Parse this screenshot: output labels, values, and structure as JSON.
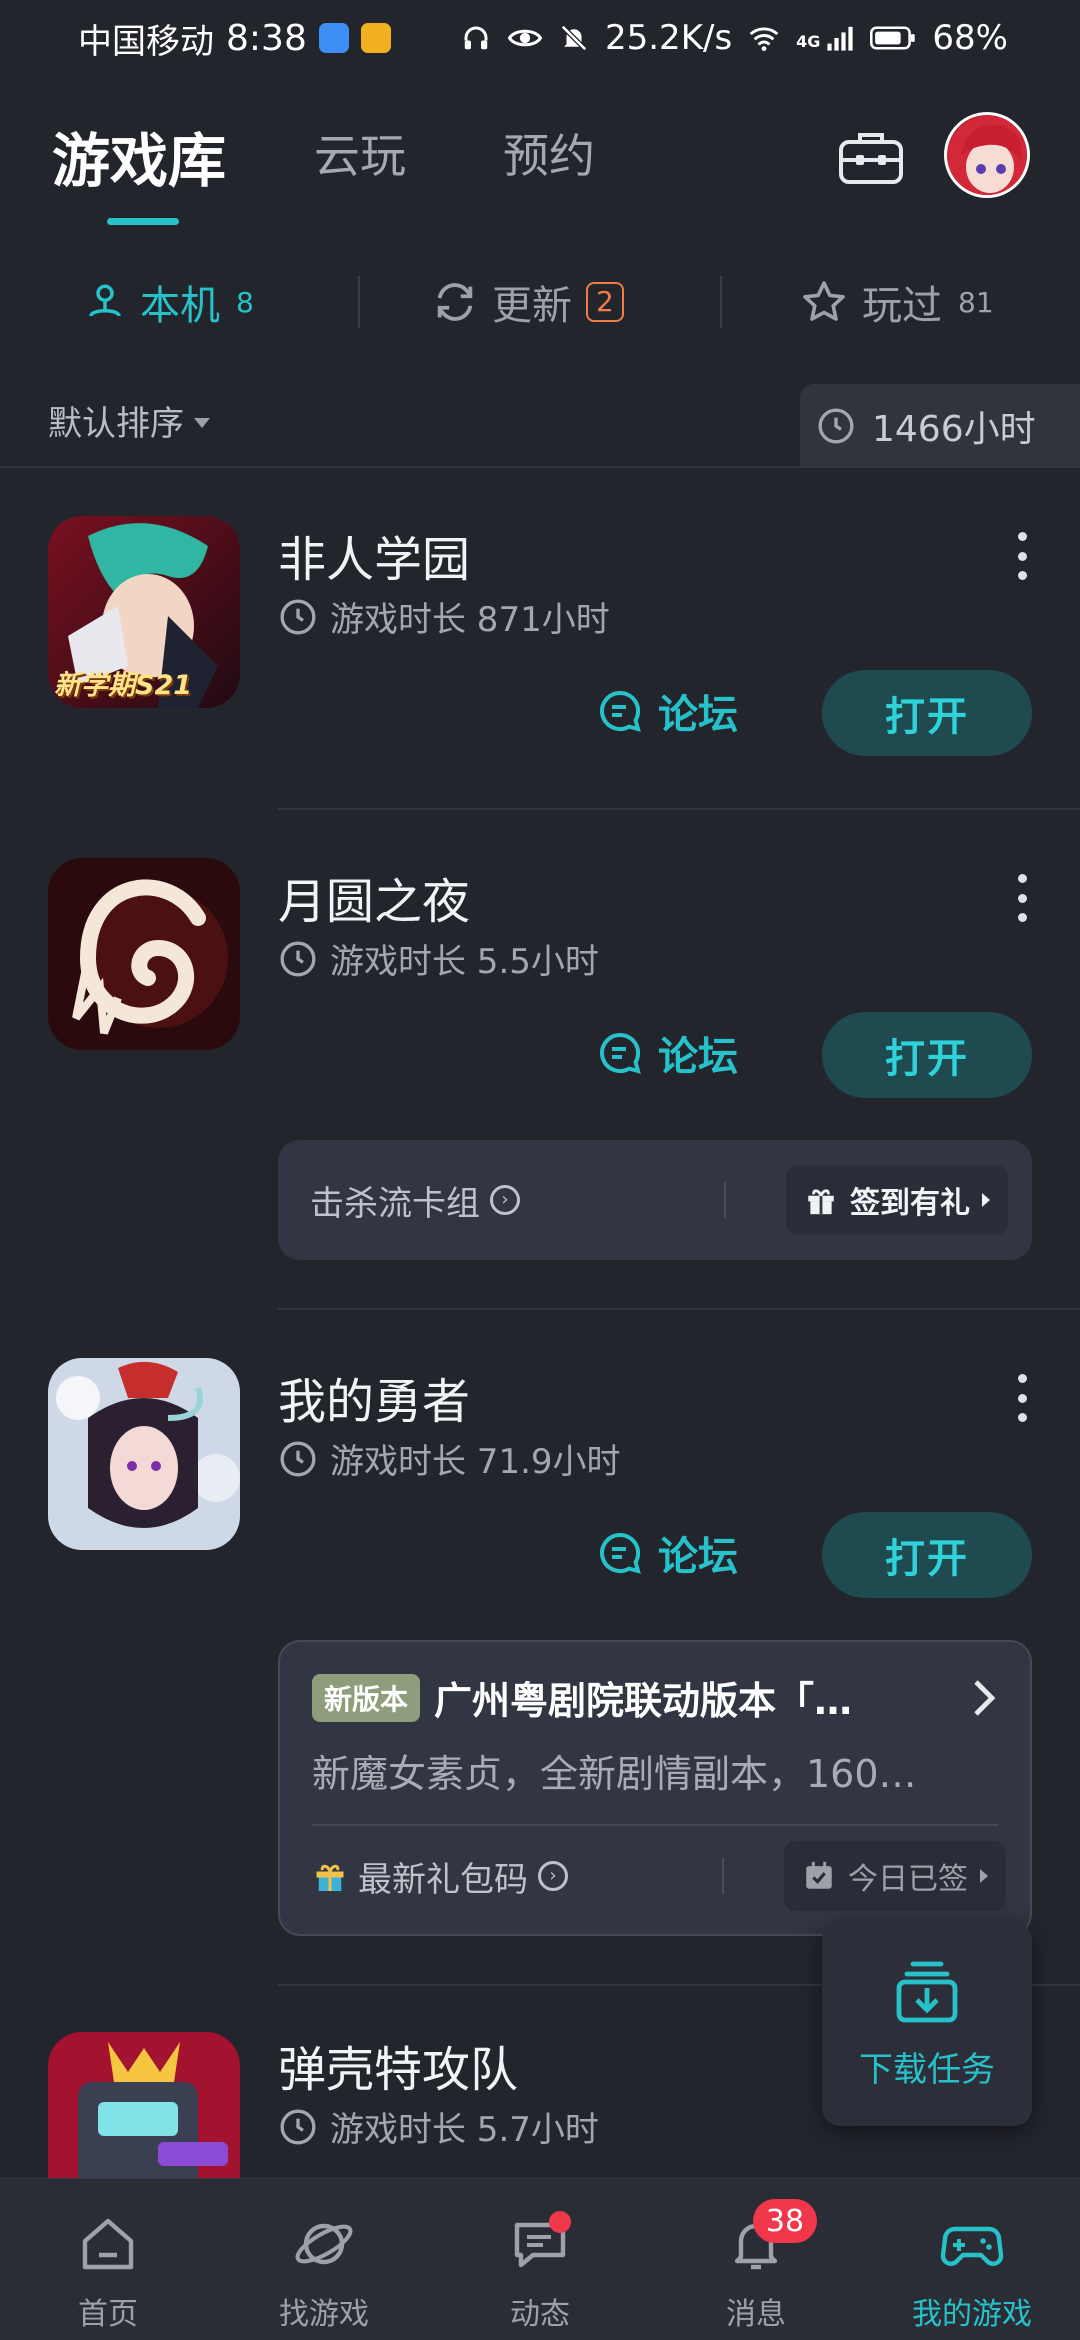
{
  "status_bar": {
    "carrier": "中国移动",
    "time": "8:38",
    "speed": "25.2K/s",
    "network": "4G",
    "battery": "68%"
  },
  "top_tabs": [
    {
      "label": "游戏库",
      "active": true
    },
    {
      "label": "云玩",
      "active": false
    },
    {
      "label": "预约",
      "active": false
    }
  ],
  "sub_tabs": [
    {
      "label": "本机",
      "count": "8",
      "icon": "local-device-icon",
      "active": true
    },
    {
      "label": "更新",
      "count": "2",
      "icon": "refresh-icon",
      "active": false
    },
    {
      "label": "玩过",
      "count": "81",
      "icon": "star-icon",
      "active": false
    }
  ],
  "sort": {
    "label": "默认排序",
    "total_time": "1466小时"
  },
  "games": [
    {
      "title": "非人学园",
      "playtime": "游戏时长 871小时",
      "forum_label": "论坛",
      "open_label": "打开",
      "icon_text": "新学期S21"
    },
    {
      "title": "月圆之夜",
      "playtime": "游戏时长 5.5小时",
      "forum_label": "论坛",
      "open_label": "打开",
      "extra": {
        "left_label": "击杀流卡组",
        "checkin_label": "签到有礼"
      }
    },
    {
      "title": "我的勇者",
      "playtime": "游戏时长 71.9小时",
      "forum_label": "论坛",
      "open_label": "打开",
      "news": {
        "tag": "新版本",
        "title": "广州粤剧院联动版本「…",
        "desc": "新魔女素贞，全新剧情副本，160…",
        "gift_label": "最新礼包码",
        "checkin_label": "今日已签"
      }
    },
    {
      "title": "弹壳特攻队",
      "playtime": "游戏时长 5.7小时"
    }
  ],
  "download_task": {
    "label": "下载任务"
  },
  "bottom_nav": [
    {
      "label": "首页",
      "icon": "home-icon",
      "active": false
    },
    {
      "label": "找游戏",
      "icon": "planet-icon",
      "active": false
    },
    {
      "label": "动态",
      "icon": "chat-icon",
      "active": false
    },
    {
      "label": "消息",
      "icon": "bell-icon",
      "badge": "38",
      "active": false
    },
    {
      "label": "我的游戏",
      "icon": "gamepad-icon",
      "active": true
    }
  ],
  "colors": {
    "background": "#23252d",
    "accent": "#27c2c9",
    "open_button_bg": "#1e4a50",
    "badge_red": "#f0384a",
    "update_badge": "#f07b45"
  }
}
